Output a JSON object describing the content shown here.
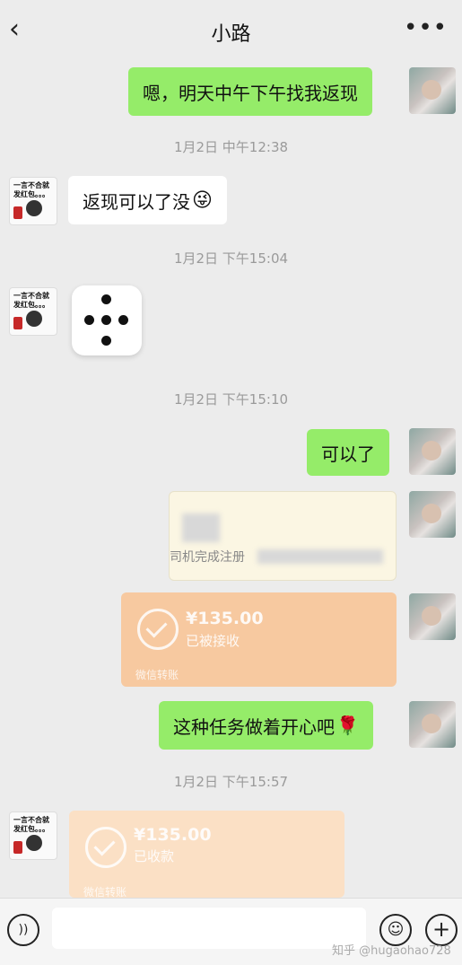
{
  "header": {
    "back_icon": "chevron-left-icon",
    "title": "小路",
    "more_icon": "more-dots-icon"
  },
  "messages": {
    "m1": "嗯，明天中午下午找我返现",
    "t1": "1月2日 中午12:38",
    "m2": "返现可以了没",
    "t2": "1月2日 下午15:04",
    "t3": "1月2日 下午15:10",
    "m3": "可以了",
    "doc_text": "司机完成注册",
    "pay1_amount": "¥135.00",
    "pay1_status": "已被接收",
    "pay1_footer": "微信转账",
    "m4": "这种任务做着开心吧",
    "t4": "1月2日 下午15:57",
    "pay2_amount": "¥135.00",
    "pay2_status": "已收款",
    "pay2_footer": "微信转账"
  },
  "avatar_other": {
    "line1": "一言不合就",
    "line2": "发红包。。。"
  },
  "emoji": {
    "m2": "😜",
    "m4": "🌹"
  },
  "bottom": {
    "voice_icon": "voice-icon",
    "emoji_icon": "emoji-icon",
    "plus_icon": "plus-icon"
  },
  "watermark": "知乎 @hugaohao728",
  "colors": {
    "green_bubble": "#95ec69",
    "pay_bubble": "#f7c9a0",
    "pay_bubble_received": "#fbe0c5"
  }
}
